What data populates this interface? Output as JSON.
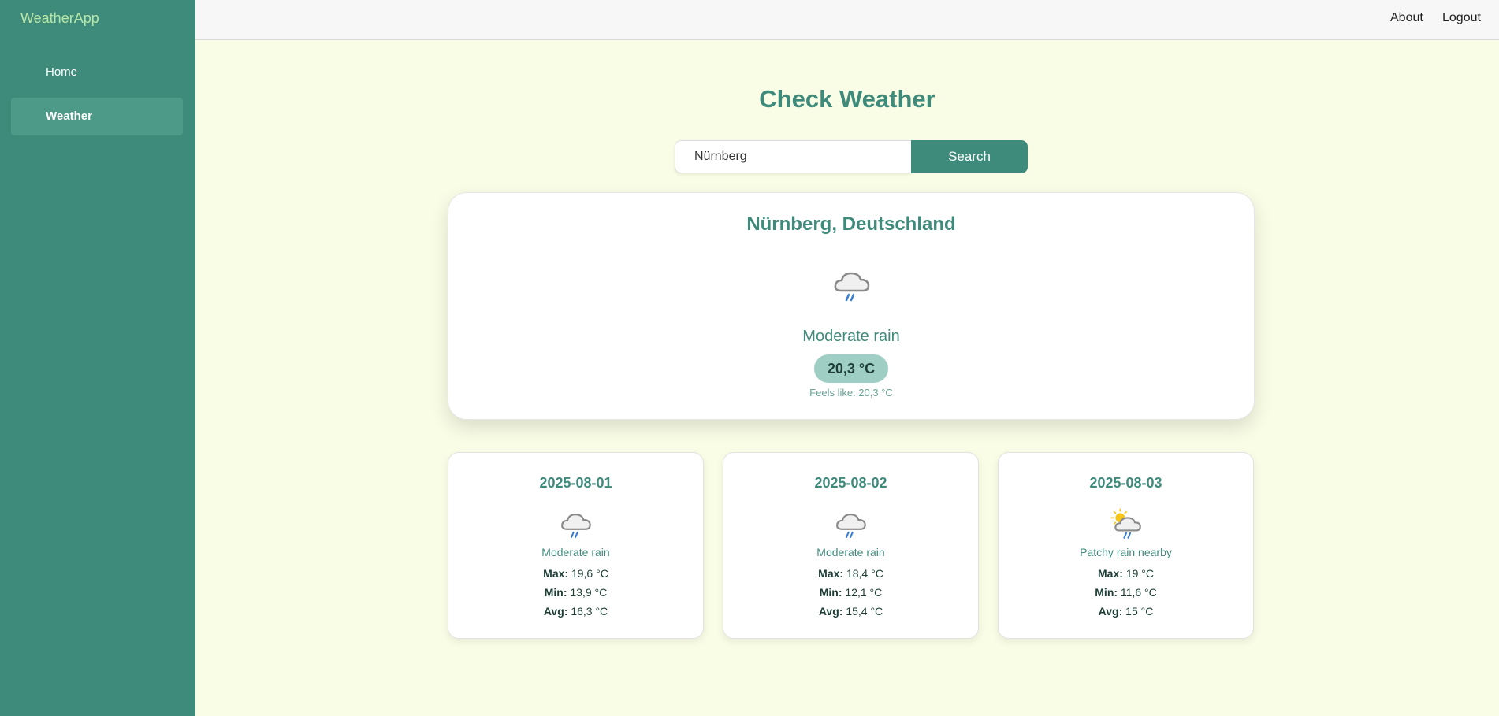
{
  "sidebar": {
    "brand": "WeatherApp",
    "items": [
      {
        "label": "Home"
      },
      {
        "label": "Weather"
      }
    ]
  },
  "topbar": {
    "about": "About",
    "logout": "Logout"
  },
  "main": {
    "title": "Check Weather",
    "search": {
      "value": "Nürnberg",
      "button": "Search"
    },
    "current": {
      "location": "Nürnberg, Deutschland",
      "icon": "rain-cloud-icon",
      "condition": "Moderate rain",
      "temperature": "20,3 °C",
      "feels_like": "Feels like: 20,3 °C"
    },
    "forecast": [
      {
        "date": "2025-08-01",
        "icon": "rain-cloud-icon",
        "condition": "Moderate rain",
        "max_label": "Max:",
        "max": "19,6 °C",
        "min_label": "Min:",
        "min": "13,9 °C",
        "avg_label": "Avg:",
        "avg": "16,3 °C"
      },
      {
        "date": "2025-08-02",
        "icon": "rain-cloud-icon",
        "condition": "Moderate rain",
        "max_label": "Max:",
        "max": "18,4 °C",
        "min_label": "Min:",
        "min": "12,1 °C",
        "avg_label": "Avg:",
        "avg": "15,4 °C"
      },
      {
        "date": "2025-08-03",
        "icon": "sun-rain-cloud-icon",
        "condition": "Patchy rain nearby",
        "max_label": "Max:",
        "max": "19 °C",
        "min_label": "Min:",
        "min": "11,6 °C",
        "avg_label": "Avg:",
        "avg": "15 °C"
      }
    ]
  },
  "colors": {
    "accent": "#3f8b7b",
    "background": "#fafde6",
    "badge": "#9fcec5"
  }
}
